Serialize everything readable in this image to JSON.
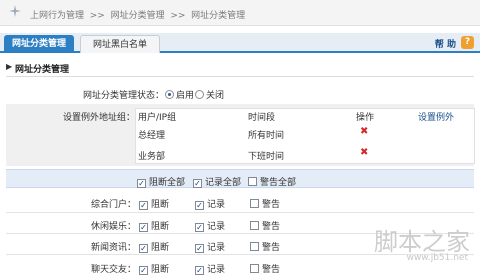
{
  "breadcrumb": [
    "上网行为管理",
    "网址分类管理",
    "网址分类管理"
  ],
  "breadcrumb_sep": ">>",
  "tabs": [
    {
      "label": "网址分类管理",
      "active": true
    },
    {
      "label": "网址黑白名单",
      "active": false
    }
  ],
  "help": {
    "label": "帮 助",
    "icon": "?"
  },
  "section": {
    "arrow": "▶",
    "title": "网址分类管理"
  },
  "status": {
    "label": "网址分类管理状态：",
    "options": [
      "启用",
      "关闭"
    ],
    "selected": "启用"
  },
  "exception": {
    "label": "设置例外地址组：",
    "headers": [
      "用户/IP组",
      "时间段",
      "操作",
      "设置例外"
    ],
    "rows": [
      {
        "group": "总经理",
        "time": "所有时间",
        "op": "✖"
      },
      {
        "group": "业务部",
        "time": "下班时间",
        "op": "✖"
      }
    ]
  },
  "bulk": {
    "block_all": "阻断全部",
    "record_all": "记录全部",
    "warn_all": "警告全部"
  },
  "categories": [
    {
      "name": "综合门户：",
      "block": "阻断",
      "record": "记录",
      "warn": "警告",
      "block_on": true,
      "record_on": true,
      "warn_on": false
    },
    {
      "name": "休闲娱乐：",
      "block": "阻断",
      "record": "记录",
      "warn": "警告",
      "block_on": true,
      "record_on": true,
      "warn_on": false
    },
    {
      "name": "新闻资讯：",
      "block": "阻断",
      "record": "记录",
      "warn": "警告",
      "block_on": true,
      "record_on": true,
      "warn_on": false
    },
    {
      "name": "聊天交友：",
      "block": "阻断",
      "record": "记录",
      "warn": "警告",
      "block_on": true,
      "record_on": true,
      "warn_on": false
    }
  ],
  "check_glyph": "✓",
  "watermark": {
    "text": "脚本之家",
    "url": "www.jb51.net"
  },
  "colors": {
    "accent": "#2d7fc4",
    "delete": "#d12a2a",
    "help": "#f0a02e"
  }
}
